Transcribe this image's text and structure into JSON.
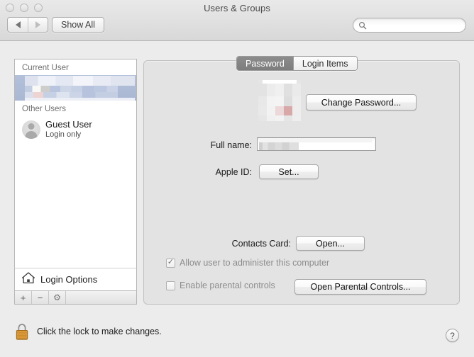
{
  "window": {
    "title": "Users & Groups",
    "traffic_lights": [
      "close-button",
      "minimize-button",
      "zoom-button"
    ]
  },
  "toolbar": {
    "back_label": "◀",
    "forward_label": "▶",
    "show_all_label": "Show All",
    "search": {
      "value": "",
      "placeholder": ""
    }
  },
  "sidebar": {
    "current_user_header": "Current User",
    "current_user": {
      "name_redacted": true,
      "selected": true
    },
    "other_users_header": "Other Users",
    "other_users": [
      {
        "name": "Guest User",
        "subtitle": "Login only"
      }
    ],
    "login_options_label": "Login Options",
    "toolbar_buttons": [
      {
        "name": "add-user-button",
        "label": "+"
      },
      {
        "name": "remove-user-button",
        "label": "−"
      },
      {
        "name": "settings-button",
        "label": "⚙"
      }
    ]
  },
  "main": {
    "tabs": [
      {
        "label": "Password",
        "selected": true
      },
      {
        "label": "Login Items",
        "selected": false
      }
    ],
    "change_password_label": "Change Password...",
    "full_name_label": "Full name:",
    "full_name_value": "",
    "apple_id_label": "Apple ID:",
    "apple_id_button_label": "Set...",
    "contacts_card_label": "Contacts Card:",
    "contacts_card_button_label": "Open...",
    "admin_checkbox": {
      "label": "Allow user to administer this computer",
      "checked": true,
      "enabled": false,
      "mark": "✓"
    },
    "parental_checkbox": {
      "label": "Enable parental controls",
      "checked": false,
      "enabled": false,
      "mark": ""
    },
    "parental_button_label": "Open Parental Controls..."
  },
  "footer": {
    "lock_text": "Click the lock to make changes.",
    "lock_state": "locked",
    "help_label": "?"
  },
  "colors": {
    "window_background": "#ececec",
    "panel_background": "#e3e3e3",
    "sidebar_background": "#ffffff",
    "selection_blue": "#b3c0da",
    "lock_gold": "#d4903a",
    "selected_tab": "#858585",
    "disabled_text": "#8c8c8c"
  }
}
